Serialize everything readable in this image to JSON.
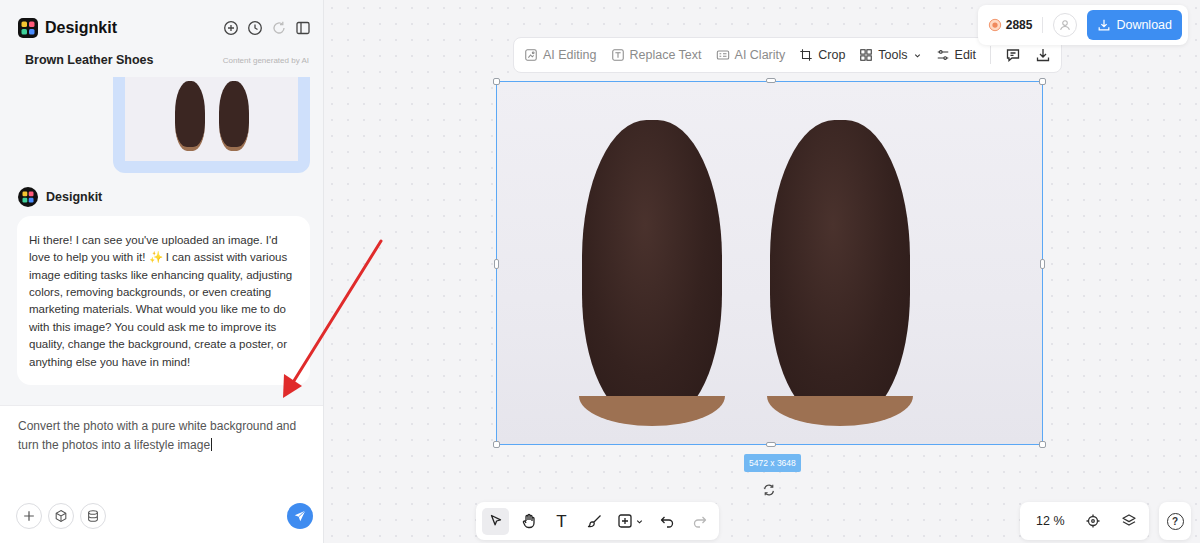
{
  "app": {
    "name": "Designkit"
  },
  "header_actions": [
    {
      "kind": "new",
      "disabled": false
    },
    {
      "kind": "history",
      "disabled": false
    },
    {
      "kind": "refresh",
      "disabled": true
    },
    {
      "kind": "sidebar",
      "disabled": false
    }
  ],
  "project": {
    "title": "Brown Leather Shoes",
    "note": "Content generated by AI"
  },
  "messages": [
    {
      "kind": "image",
      "from": "user"
    },
    {
      "kind": "text",
      "from": "assistant",
      "author": "Designkit",
      "text": "Hi there! I can see you've uploaded an image. I'd love to help you with it! ✨ I can assist with various image editing tasks like enhancing quality, adjusting colors, removing backgrounds, or even creating marketing materials. What would you like me to do with this image? You could ask me to improve its quality, change the background, create a poster, or anything else you have in mind!"
    }
  ],
  "input": {
    "value": "Convert the photo with a pure white background and turn the photos into a lifestyle image"
  },
  "input_actions": [
    {
      "kind": "add"
    },
    {
      "kind": "model"
    },
    {
      "kind": "library"
    }
  ],
  "send": {
    "disabled": false
  },
  "toolbar": [
    {
      "kind": "ai-editing",
      "label": "AI Editing",
      "disabled": true,
      "has_menu": false
    },
    {
      "kind": "replace-text",
      "label": "Replace Text",
      "disabled": true,
      "has_menu": false
    },
    {
      "kind": "ai-clarity",
      "label": "AI Clarity",
      "disabled": true,
      "has_menu": false
    },
    {
      "kind": "crop",
      "label": "Crop",
      "disabled": false,
      "has_menu": false
    },
    {
      "kind": "tools",
      "label": "Tools",
      "disabled": false,
      "has_menu": true
    },
    {
      "kind": "edit",
      "label": "Edit",
      "disabled": false,
      "has_menu": false
    }
  ],
  "toolbar_actions": [
    {
      "kind": "comment"
    },
    {
      "kind": "export"
    }
  ],
  "account": {
    "credits": "2885"
  },
  "download": {
    "label": "Download"
  },
  "canvas": {
    "image": {
      "size": "5472 x 3648",
      "selected": true
    }
  },
  "tools": [
    {
      "kind": "select",
      "glyph": "",
      "selected": true,
      "disabled": false,
      "has_menu": false
    },
    {
      "kind": "hand",
      "glyph": "",
      "selected": false,
      "disabled": false,
      "has_menu": false
    },
    {
      "kind": "text",
      "glyph": "T",
      "selected": false,
      "disabled": false,
      "has_menu": false
    },
    {
      "kind": "brush",
      "glyph": "",
      "selected": false,
      "disabled": false,
      "has_menu": false
    },
    {
      "kind": "insert",
      "glyph": "",
      "selected": false,
      "disabled": false,
      "has_menu": true
    },
    {
      "kind": "undo",
      "glyph": "",
      "selected": false,
      "disabled": false,
      "has_menu": false
    },
    {
      "kind": "redo",
      "glyph": "",
      "selected": false,
      "disabled": true,
      "has_menu": false
    }
  ],
  "zoom": {
    "value": "12 %"
  },
  "help": {
    "glyph": "?"
  }
}
